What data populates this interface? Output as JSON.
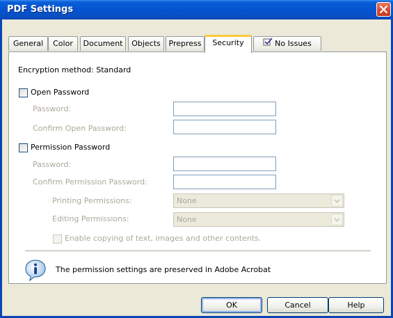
{
  "window": {
    "title": "PDF Settings"
  },
  "tabs": [
    {
      "label": "General"
    },
    {
      "label": "Color"
    },
    {
      "label": "Document"
    },
    {
      "label": "Objects"
    },
    {
      "label": "Prepress"
    },
    {
      "label": "Security"
    },
    {
      "label": "No Issues",
      "icon": "checklist-icon"
    }
  ],
  "active_tab": "Security",
  "security": {
    "encryption_method": "Encryption method: Standard",
    "open_password": {
      "label": "Open Password",
      "checked": false,
      "password_label": "Password:",
      "confirm_label": "Confirm Open Password:"
    },
    "permission_password": {
      "label": "Permission Password",
      "checked": false,
      "password_label": "Password:",
      "confirm_label": "Confirm Permission Password:",
      "printing_label": "Printing Permissions:",
      "printing_value": "None",
      "editing_label": "Editing Permissions:",
      "editing_value": "None",
      "enable_copying_label": "Enable copying of text, images and other contents.",
      "enable_copying_checked": false
    },
    "info_message": "The permission settings are preserved in Adobe Acrobat"
  },
  "buttons": {
    "ok": "OK",
    "cancel": "Cancel",
    "help": "Help"
  },
  "colors": {
    "titlebar": "#0553d0",
    "active_tab_highlight": "#ffc83c",
    "disabled_text": "#aca899"
  }
}
